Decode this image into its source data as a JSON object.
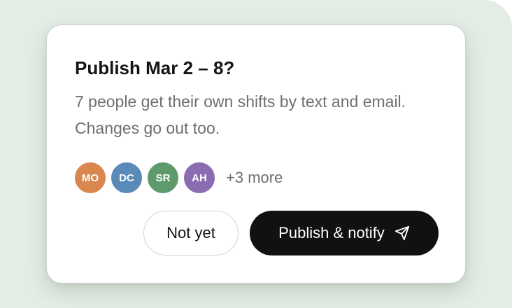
{
  "dialog": {
    "title": "Publish Mar 2 – 8?",
    "description": "7 people get their own shifts by text and email. Changes go out too.",
    "recipients": [
      {
        "initials": "MO",
        "color": "#d9864f"
      },
      {
        "initials": "DC",
        "color": "#5a8ab8"
      },
      {
        "initials": "SR",
        "color": "#5e9a6b"
      },
      {
        "initials": "AH",
        "color": "#8a6cb0"
      }
    ],
    "more_label": "+3 more",
    "secondary_label": "Not yet",
    "primary_label": "Publish & notify",
    "primary_icon": "send-icon"
  },
  "colors": {
    "backdrop": "#e3ece5",
    "primary_button": "#111111"
  }
}
